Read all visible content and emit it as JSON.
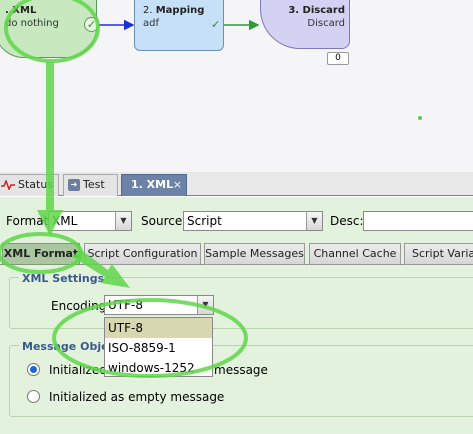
{
  "flow": {
    "nodes": [
      {
        "title": ". XML",
        "subtitle": "do nothing"
      },
      {
        "number": "2. ",
        "title": "Mapping",
        "subtitle": "adf"
      },
      {
        "title": "3. Discard",
        "subtitle": "Discard"
      }
    ],
    "discard_counter": "0"
  },
  "tabs": [
    {
      "label": "Status"
    },
    {
      "label": "Test"
    },
    {
      "label": "1. XML",
      "close": "×"
    }
  ],
  "toolbar": {
    "format_label": "Format:",
    "format_value": "XML",
    "source_label": "Source:",
    "source_value": "Script",
    "desc_label": "Desc:",
    "desc_value": ""
  },
  "subtabs": [
    "XML Format",
    "Script Configuration",
    "Sample Messages",
    "Channel Cache",
    "Script Variab"
  ],
  "xml_settings": {
    "legend": "XML Settings",
    "encoding_label": "Encoding:",
    "encoding_value": "UTF-8",
    "options": [
      "UTF-8",
      "ISO-8859-1",
      "windows-1252"
    ]
  },
  "message_object": {
    "legend": "Message Object",
    "radio1_label": "Initialized as copy of incoming message",
    "radio1_visible": "message",
    "radio1_prefix": "Initialized a",
    "radio2_label": "Initialized as empty message"
  },
  "colors": {
    "callout": "#5fd64a",
    "active_tab": "#6c82a6",
    "panel": "#e2f2dc",
    "edge": "#1f2fd6"
  }
}
